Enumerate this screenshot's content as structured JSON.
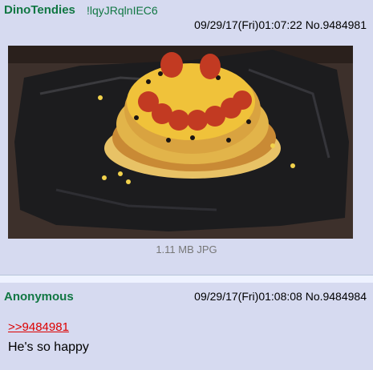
{
  "posts": [
    {
      "name": "DinoTendies",
      "tripcode": "!lqyJRqlnIEC6",
      "datetime": "09/29/17(Fri)01:07:22",
      "number": "No.9484981",
      "file": {
        "size_type": "1.11 MB JPG"
      }
    },
    {
      "name": "Anonymous",
      "datetime": "09/29/17(Fri)01:08:08",
      "number": "No.9484984",
      "quote": ">>9484981",
      "comment": "He's so happy"
    }
  ],
  "colors": {
    "name_green": "#117743",
    "post_bg": "#d6daf0",
    "page_bg": "#eef2ff",
    "link_red": "#dd0000"
  }
}
